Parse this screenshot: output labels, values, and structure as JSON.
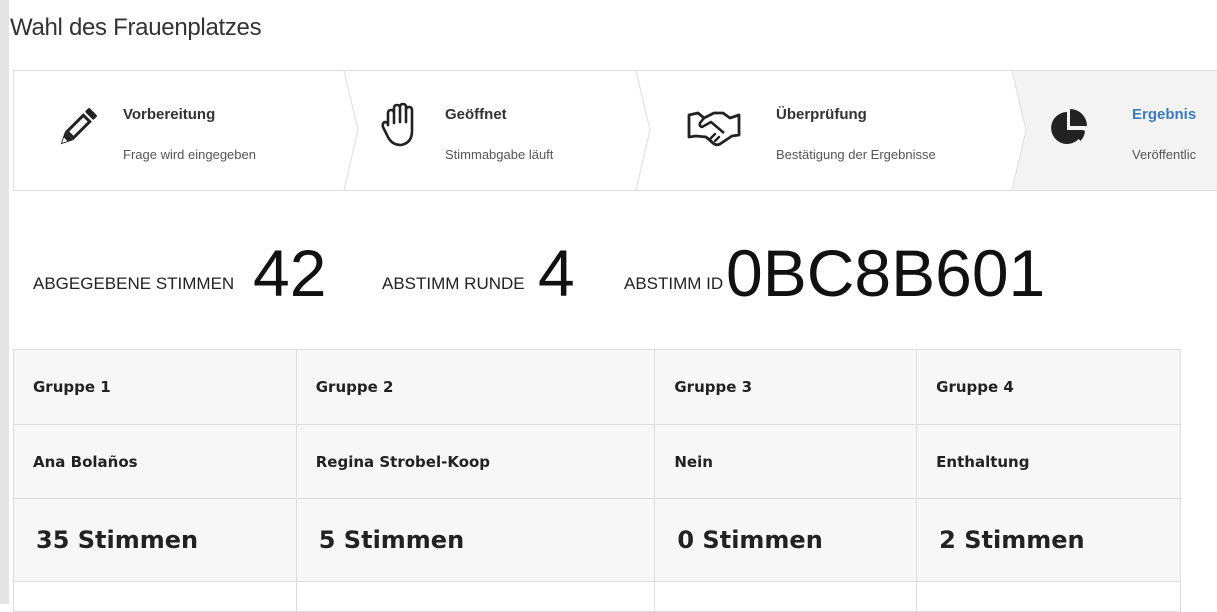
{
  "page": {
    "title": "Wahl des Frauenplatzes"
  },
  "steps": [
    {
      "title": "Vorbereitung",
      "desc": "Frage wird eingegeben",
      "icon": "pencil-icon",
      "active": false
    },
    {
      "title": "Geöffnet",
      "desc": "Stimmabgabe läuft",
      "icon": "raised-hand-icon",
      "active": false
    },
    {
      "title": "Überprüfung",
      "desc": "Bestätigung der Ergebnisse",
      "icon": "handshake-icon",
      "active": false
    },
    {
      "title": "Ergebnis",
      "desc": "Veröffentlic",
      "icon": "pie-chart-icon",
      "active": true
    }
  ],
  "stats": {
    "votes_label": "ABGEGEBENE STIMMEN",
    "votes_value": "42",
    "round_label": "ABSTIMM RUNDE",
    "round_value": "4",
    "id_label": "ABSTIMM ID",
    "id_value": "0BC8B601"
  },
  "table": {
    "groups": [
      "Gruppe 1",
      "Gruppe 2",
      "Gruppe 3",
      "Gruppe 4"
    ],
    "options": [
      "Ana Bolaños",
      "Regina Strobel-Koop",
      "Nein",
      "Enthaltung"
    ],
    "votes": [
      "35 Stimmen",
      "5 Stimmen",
      "0 Stimmen",
      "2 Stimmen"
    ]
  },
  "colors": {
    "accent": "#3a7bbf",
    "active_step_bg": "#f3f3f3"
  }
}
